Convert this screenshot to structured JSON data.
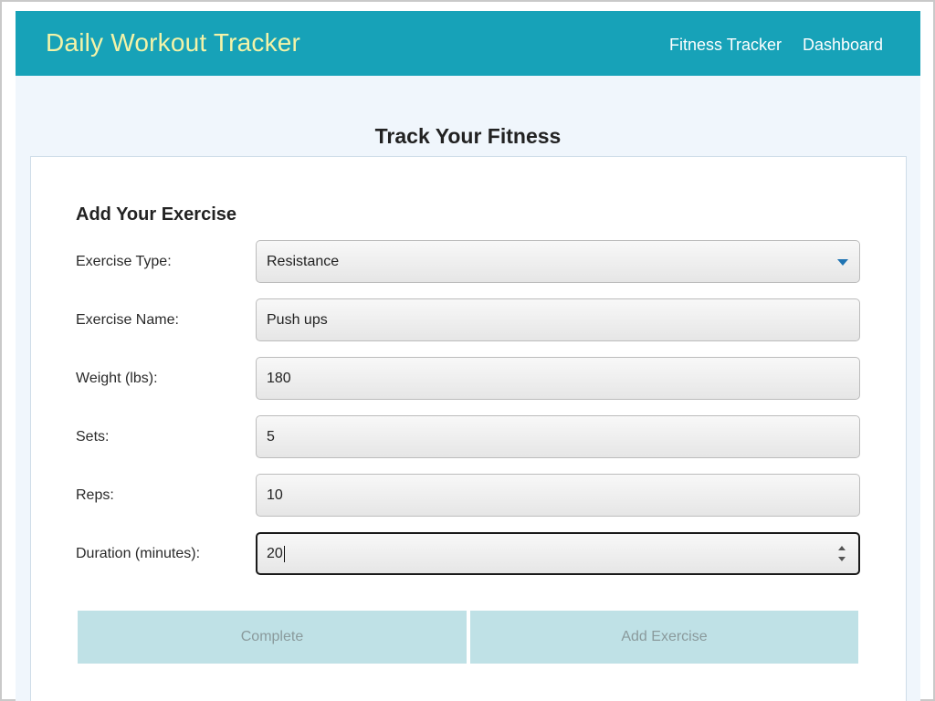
{
  "navbar": {
    "brand": "Daily Workout Tracker",
    "links": [
      "Fitness Tracker",
      "Dashboard"
    ]
  },
  "page_title": "Track Your Fitness",
  "form": {
    "heading": "Add Your Exercise",
    "fields": [
      {
        "label": "Exercise Type:",
        "value": "Resistance",
        "kind": "select"
      },
      {
        "label": "Exercise Name:",
        "value": "Push ups",
        "kind": "text"
      },
      {
        "label": "Weight (lbs):",
        "value": "180",
        "kind": "text"
      },
      {
        "label": "Sets:",
        "value": "5",
        "kind": "text"
      },
      {
        "label": "Reps:",
        "value": "10",
        "kind": "text"
      },
      {
        "label": "Duration (minutes):",
        "value": "20",
        "kind": "number"
      }
    ],
    "buttons": {
      "complete": "Complete",
      "add_exercise": "Add Exercise"
    }
  },
  "colors": {
    "navbar_bg": "#17a2b8",
    "brand_text": "#f3f3a8",
    "page_bg": "#f0f6fc",
    "button_bg": "#bfe1e6",
    "select_arrow": "#1f74b3"
  },
  "icons": {
    "select_arrow": "chevron-down-icon",
    "spinner": "number-spinner-icon"
  }
}
